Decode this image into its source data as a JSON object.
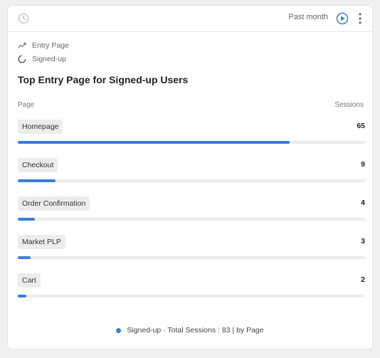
{
  "header": {
    "period": "Past month"
  },
  "legend": {
    "metric": "Entry Page",
    "segment": "Signed-up"
  },
  "title": "Top Entry Page for Signed-up Users",
  "columns": {
    "page": "Page",
    "sessions": "Sessions"
  },
  "rows": [
    {
      "label": "Homepage",
      "value": 65,
      "value_text": "65"
    },
    {
      "label": "Checkout",
      "value": 9,
      "value_text": "9"
    },
    {
      "label": "Order Confirmation",
      "value": 4,
      "value_text": "4"
    },
    {
      "label": "Market PLP",
      "value": 3,
      "value_text": "3"
    },
    {
      "label": "Cart",
      "value": 2,
      "value_text": "2"
    }
  ],
  "bar_max": 83,
  "footer": {
    "text": "Signed-up · Total Sessions : 83 | by Page"
  },
  "colors": {
    "accent": "#3b7dd8",
    "track": "#ececec"
  },
  "icons": [
    "clock-icon",
    "play-icon",
    "more-icon",
    "trend-line-icon",
    "spinner-icon"
  ]
}
